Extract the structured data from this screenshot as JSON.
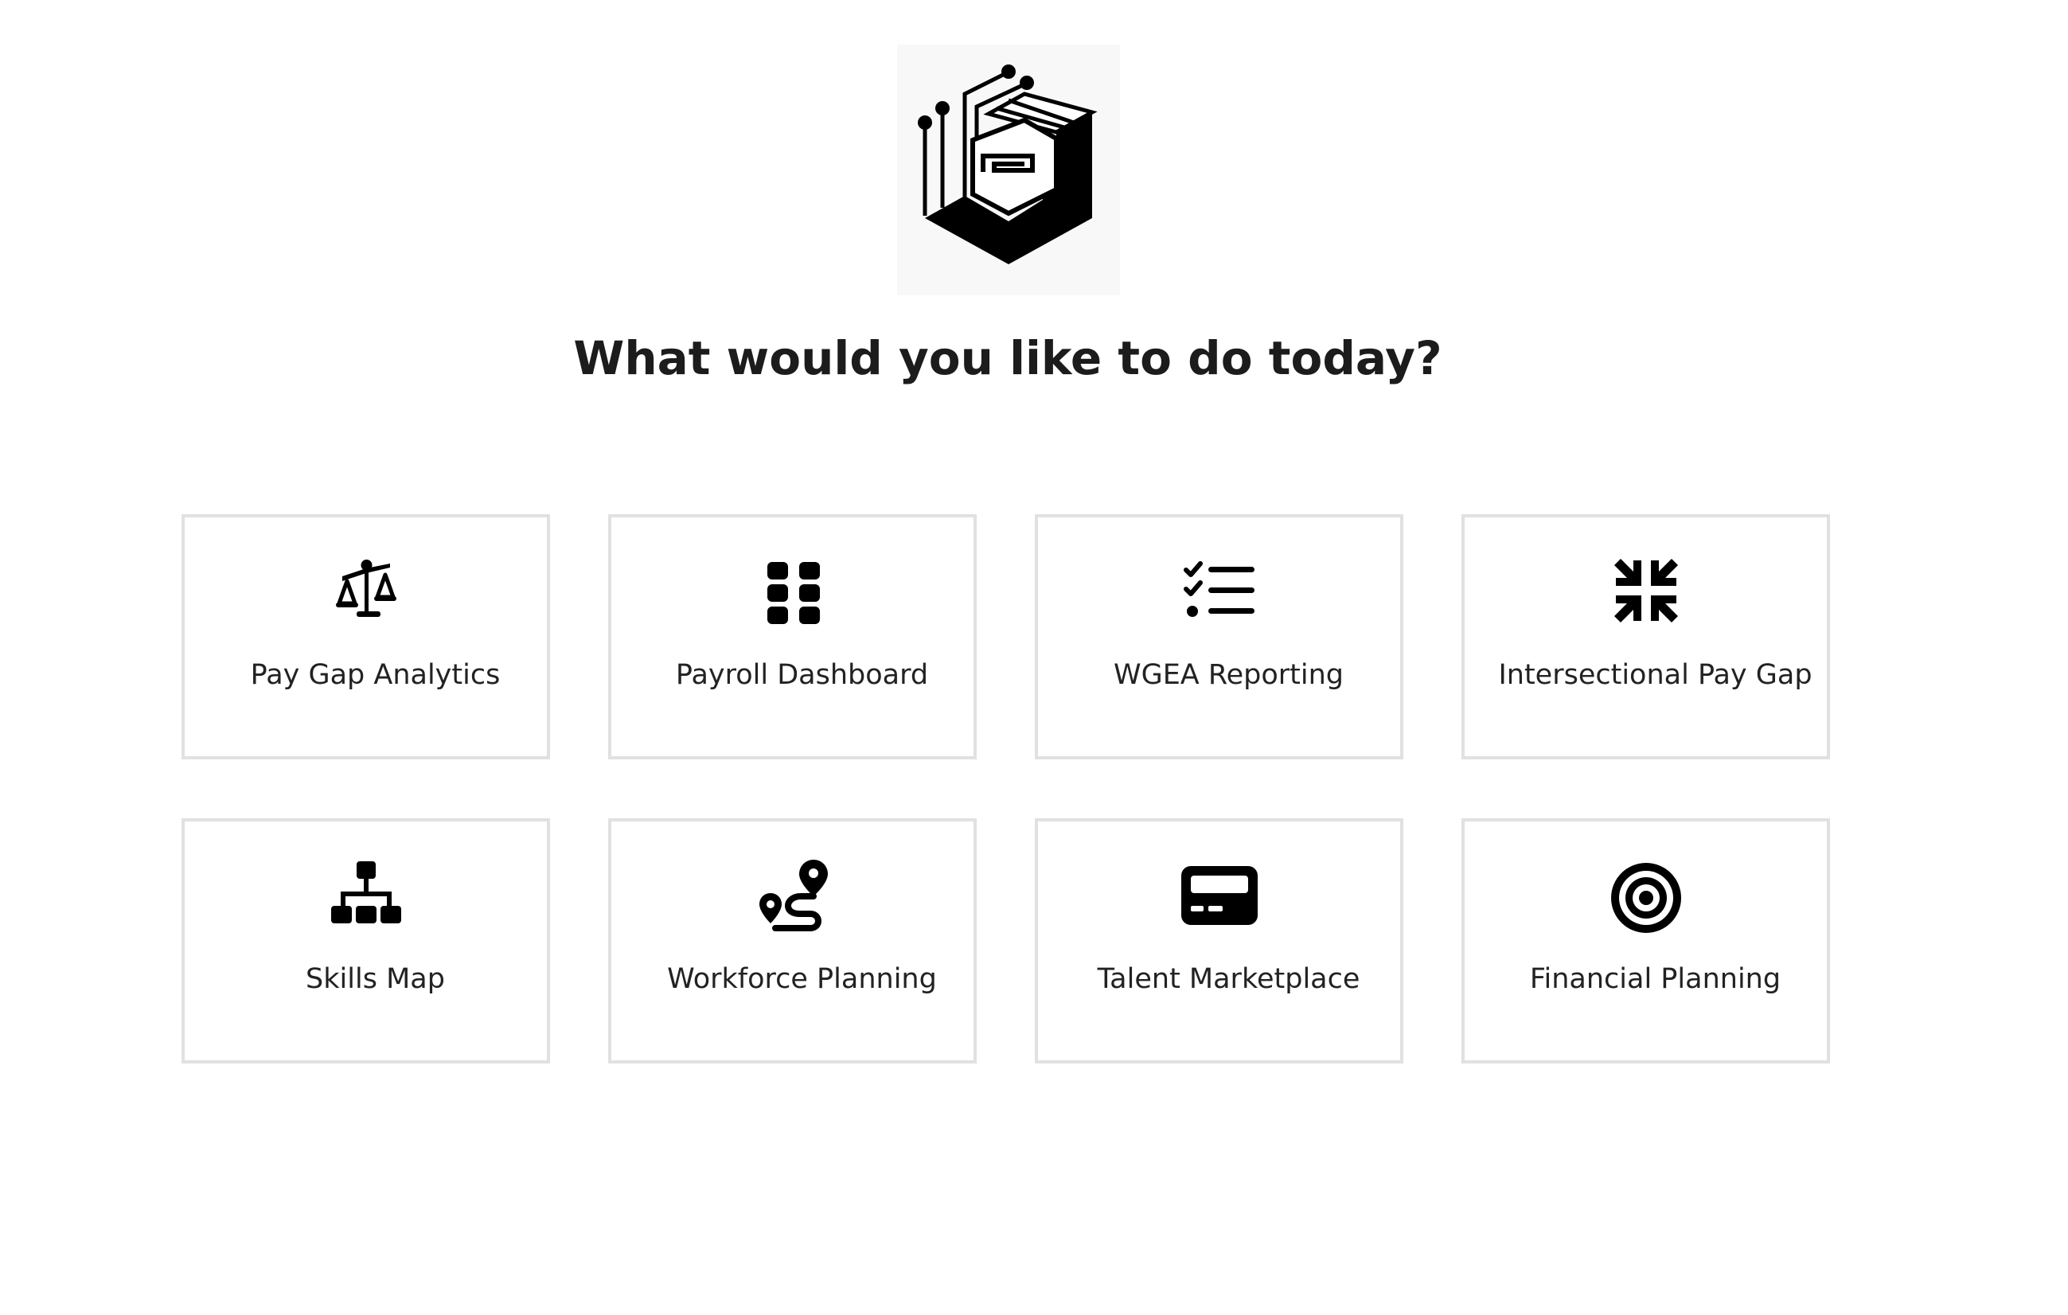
{
  "header": {
    "title": "What would you like to do today?",
    "logo_icon": "isometric-circuit-cube-logo"
  },
  "colors": {
    "background": "#ffffff",
    "card_border": "#e1e1e1",
    "text": "#1c1c1c",
    "icon": "#000000"
  },
  "cards": [
    {
      "label": "Pay Gap Analytics",
      "icon": "scale-balance-icon"
    },
    {
      "label": "Payroll Dashboard",
      "icon": "grid-dots-icon"
    },
    {
      "label": "WGEA Reporting",
      "icon": "checklist-icon"
    },
    {
      "label": "Intersectional Pay Gap",
      "icon": "compress-arrows-icon"
    },
    {
      "label": "Skills Map",
      "icon": "org-chart-icon"
    },
    {
      "label": "Workforce Planning",
      "icon": "route-pin-icon"
    },
    {
      "label": "Talent Marketplace",
      "icon": "card-icon"
    },
    {
      "label": "Financial Planning",
      "icon": "target-icon"
    }
  ]
}
